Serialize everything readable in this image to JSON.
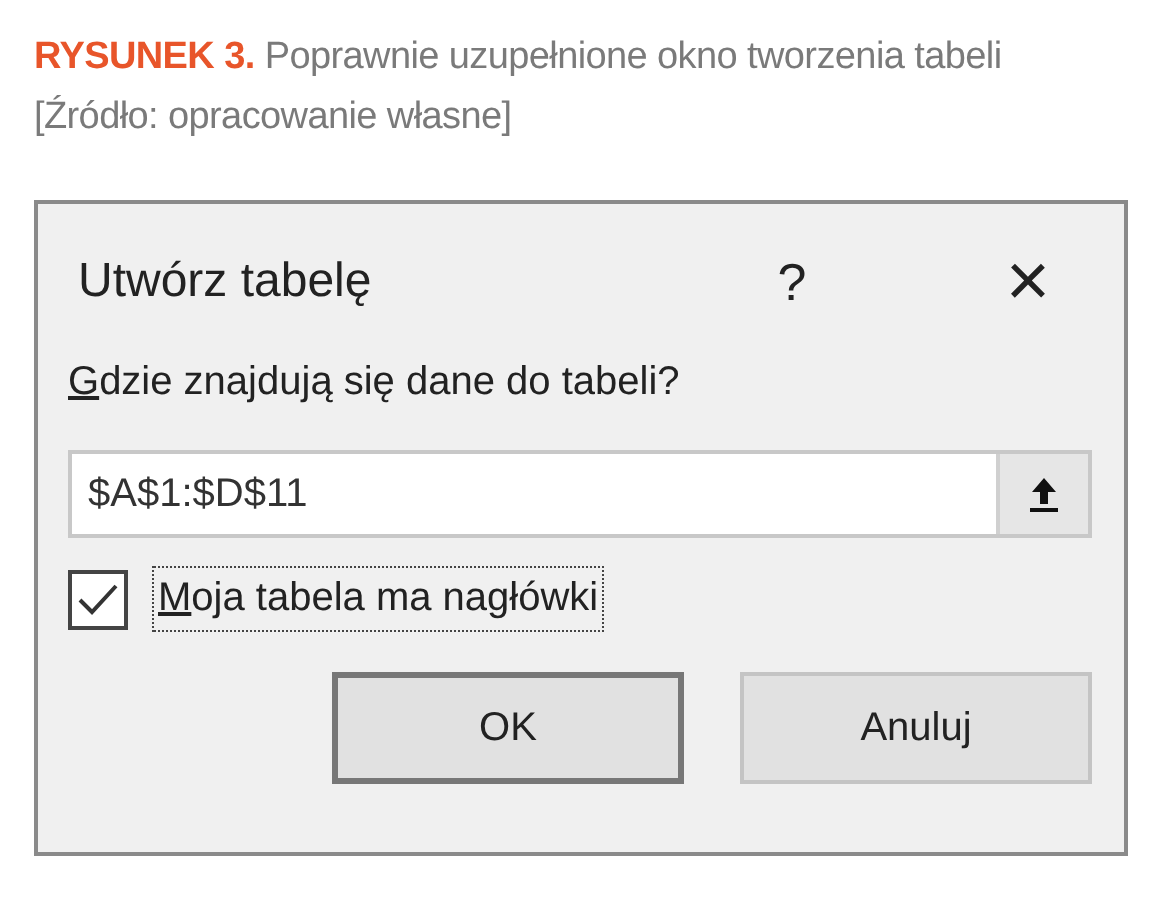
{
  "figure_caption": {
    "label": "RYSUNEK 3.",
    "text": "Poprawnie uzupełnione okno tworzenia tabeli",
    "source": "[Źródło: opracowanie własne]"
  },
  "dialog": {
    "title": "Utwórz tabelę",
    "help": "?",
    "close": "×",
    "range_label": {
      "text": "Gdzie znajdują się dane do tabeli?",
      "underline_first": true
    },
    "range_field": {
      "value": "$A$1:$D$11"
    },
    "headers_checkbox": {
      "label": "Moja tabela ma nagłówki",
      "underline_first": true,
      "checked": true,
      "focused": true
    },
    "buttons": [
      {
        "label": "OK",
        "default": true
      },
      {
        "label": "Anuluj",
        "default": false
      }
    ]
  }
}
